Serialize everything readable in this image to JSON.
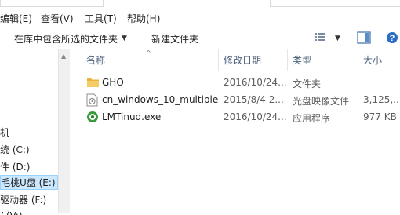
{
  "menu": {
    "items": [
      {
        "label": "编辑(E)"
      },
      {
        "label": "查看(V)"
      },
      {
        "label": "工具(T)"
      },
      {
        "label": "帮助(H)"
      }
    ]
  },
  "toolbar": {
    "include_in_library": "在库中包含所选的文件夹",
    "new_folder": "新建文件夹"
  },
  "columns": {
    "name": "名称",
    "modified": "修改日期",
    "type": "类型",
    "size": "大小"
  },
  "files": [
    {
      "name": "GHO",
      "modified": "2016/10/24...",
      "type": "文件夹",
      "size": "",
      "icon": "folder-icon"
    },
    {
      "name": "cn_windows_10_multiple_",
      "modified": "2015/8/4 2...",
      "type": "光盘映像文件",
      "size": "3,125,...",
      "icon": "disc-image-icon"
    },
    {
      "name": "LMTinud.exe",
      "modified": "2016/10/24...",
      "type": "应用程序",
      "size": "977 KB",
      "icon": "app-icon"
    }
  ],
  "nav": {
    "items": [
      {
        "label": "机"
      },
      {
        "label": "统 (C:)"
      },
      {
        "label": "件 (D:)"
      },
      {
        "label": "毛桃U盘 (E:)"
      },
      {
        "label": "驱动器 (F:)"
      },
      {
        "label": "/ (V:)"
      }
    ]
  },
  "colors": {
    "selection_bg": "#cce8ff",
    "selection_border": "#99d1ff",
    "header_text": "#4c607a",
    "folder_yellow": "#e8b43c",
    "app_green": "#3a9b3a"
  }
}
